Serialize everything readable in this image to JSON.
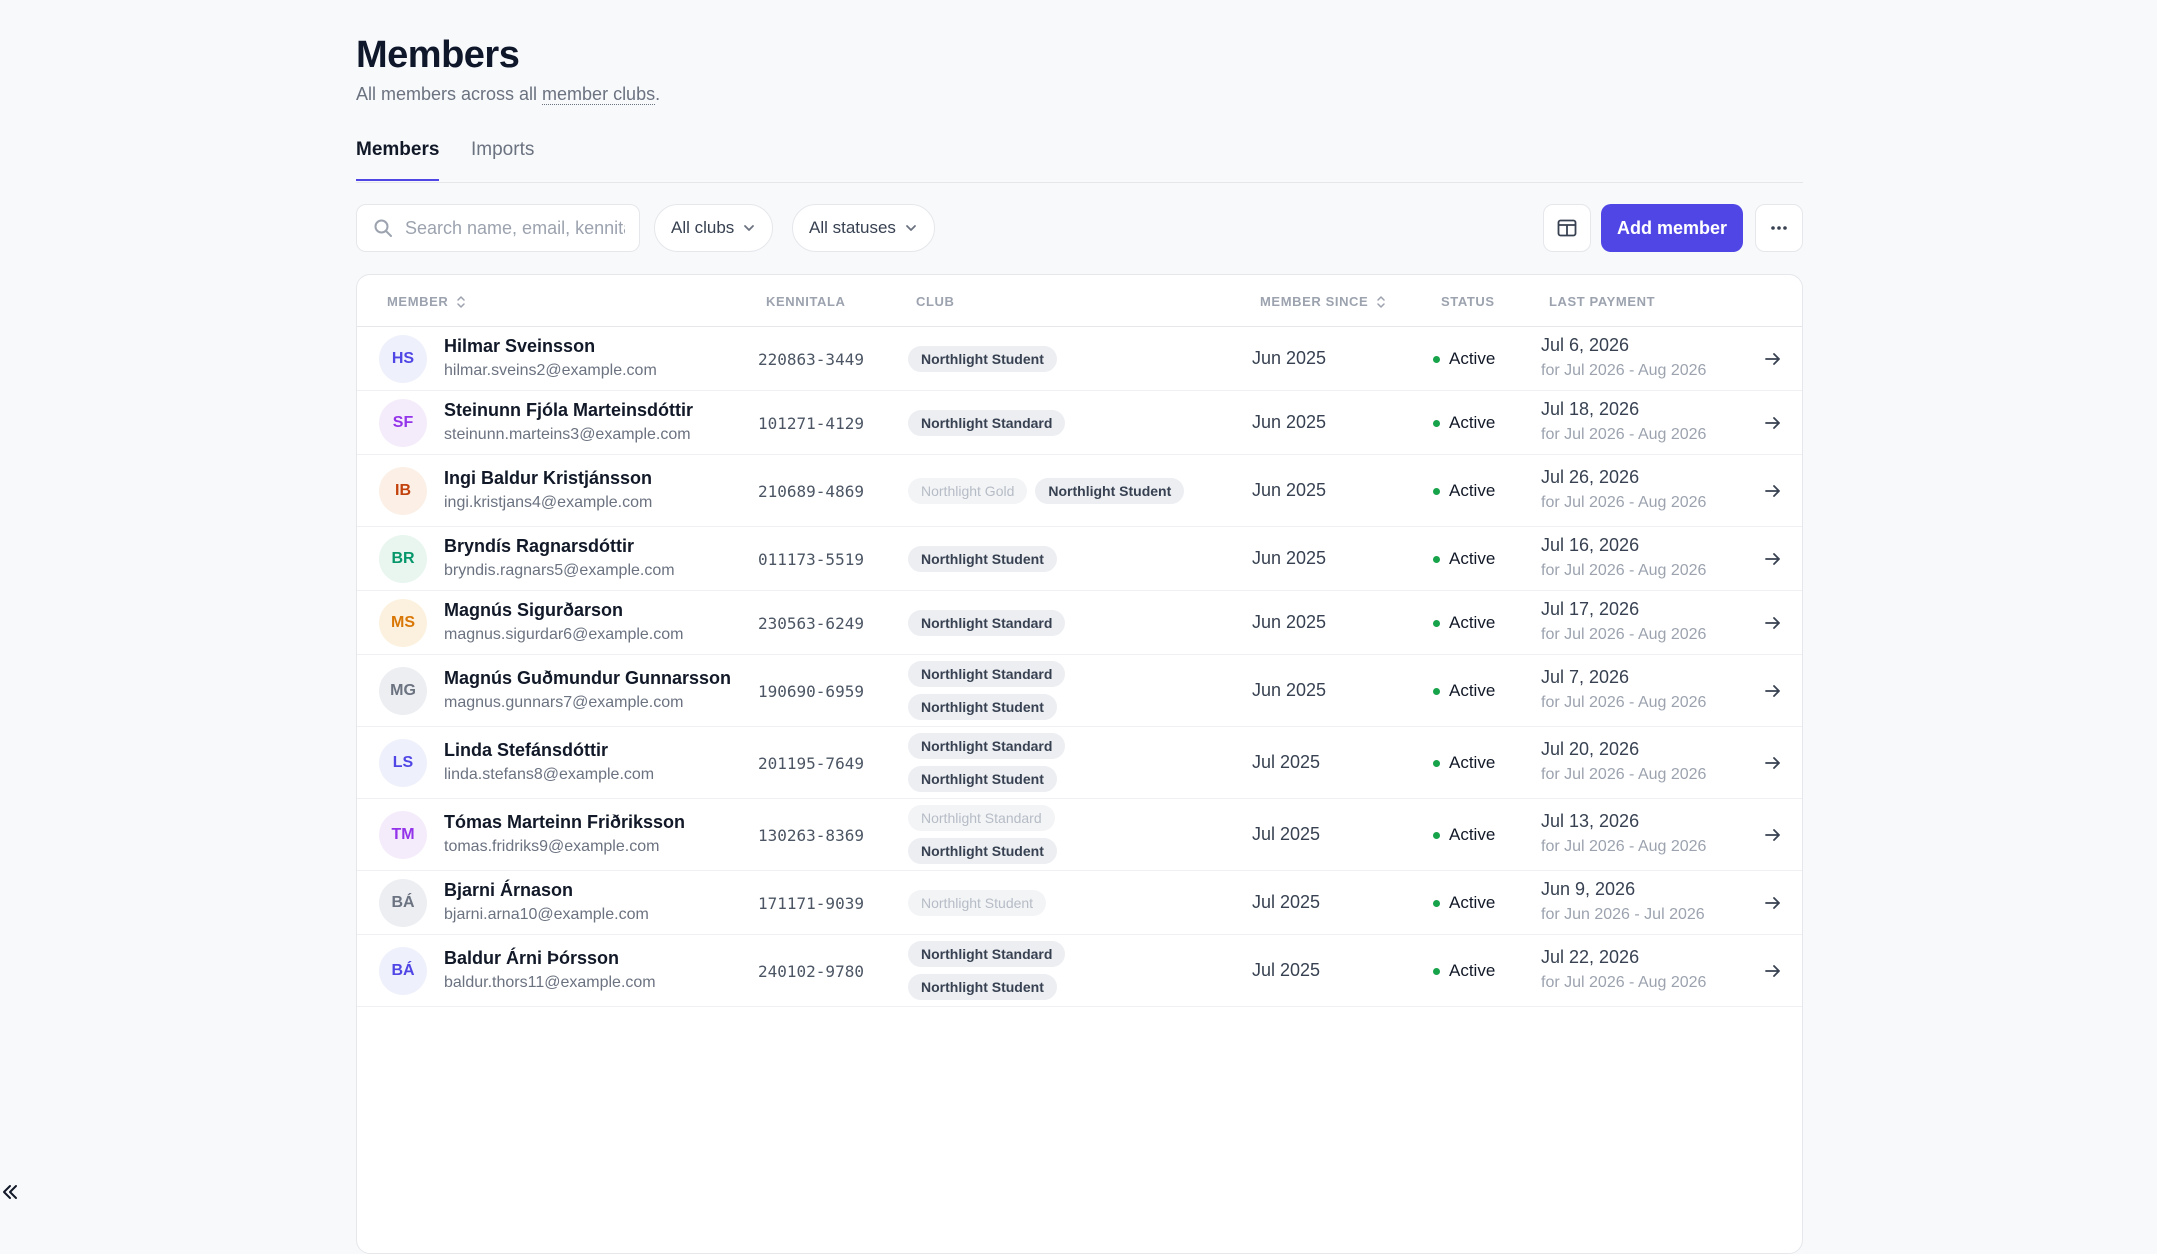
{
  "header": {
    "title": "Members",
    "subtitle_prefix": "All members across all ",
    "subtitle_link": "member clubs",
    "subtitle_suffix": "."
  },
  "tabs": [
    {
      "label": "Members",
      "active": true
    },
    {
      "label": "Imports",
      "active": false
    }
  ],
  "toolbar": {
    "search_placeholder": "Search name, email, kennitala",
    "clubs_filter": "All clubs",
    "status_filter": "All statuses",
    "add_member_label": "Add member"
  },
  "table": {
    "columns": {
      "member": "MEMBER",
      "kennitala": "KENNITALA",
      "club": "CLUB",
      "member_since": "MEMBER SINCE",
      "status": "STATUS",
      "last_payment": "LAST PAYMENT"
    },
    "rows": [
      {
        "initials": "HS",
        "avatar_bg": "#eef0fb",
        "avatar_fg": "#4f46e5",
        "name": "Hilmar Sveinsson",
        "email": "hilmar.sveins2@example.com",
        "kennitala": "220863-3449",
        "clubs": [
          {
            "name": "Northlight Student",
            "active": true
          }
        ],
        "since": "Jun 2025",
        "status": "Active",
        "pay_date": "Jul 6, 2026",
        "pay_range": "for Jul 2026 - Aug 2026"
      },
      {
        "initials": "SF",
        "avatar_bg": "#f5ecfb",
        "avatar_fg": "#9333ea",
        "name": "Steinunn Fjóla Marteinsdóttir",
        "email": "steinunn.marteins3@example.com",
        "kennitala": "101271-4129",
        "clubs": [
          {
            "name": "Northlight Standard",
            "active": true
          }
        ],
        "since": "Jun 2025",
        "status": "Active",
        "pay_date": "Jul 18, 2026",
        "pay_range": "for Jul 2026 - Aug 2026"
      },
      {
        "initials": "IB",
        "avatar_bg": "#fbefe6",
        "avatar_fg": "#c2410c",
        "name": "Ingi Baldur Kristjánsson",
        "email": "ingi.kristjans4@example.com",
        "kennitala": "210689-4869",
        "clubs": [
          {
            "name": "Northlight Gold",
            "active": false
          },
          {
            "name": "Northlight Student",
            "active": true
          }
        ],
        "since": "Jun 2025",
        "status": "Active",
        "pay_date": "Jul 26, 2026",
        "pay_range": "for Jul 2026 - Aug 2026"
      },
      {
        "initials": "BR",
        "avatar_bg": "#e8f6ef",
        "avatar_fg": "#059669",
        "name": "Bryndís Ragnarsdóttir",
        "email": "bryndis.ragnars5@example.com",
        "kennitala": "011173-5519",
        "clubs": [
          {
            "name": "Northlight Student",
            "active": true
          }
        ],
        "since": "Jun 2025",
        "status": "Active",
        "pay_date": "Jul 16, 2026",
        "pay_range": "for Jul 2026 - Aug 2026"
      },
      {
        "initials": "MS",
        "avatar_bg": "#fcf1de",
        "avatar_fg": "#d97706",
        "name": "Magnús Sigurðarson",
        "email": "magnus.sigurdar6@example.com",
        "kennitala": "230563-6249",
        "clubs": [
          {
            "name": "Northlight Standard",
            "active": true
          }
        ],
        "since": "Jun 2025",
        "status": "Active",
        "pay_date": "Jul 17, 2026",
        "pay_range": "for Jul 2026 - Aug 2026"
      },
      {
        "initials": "MG",
        "avatar_bg": "#eceef2",
        "avatar_fg": "#6b7280",
        "name": "Magnús Guðmundur Gunnarsson",
        "email": "magnus.gunnars7@example.com",
        "kennitala": "190690-6959",
        "clubs": [
          {
            "name": "Northlight Standard",
            "active": true
          },
          {
            "name": "Northlight Student",
            "active": true
          }
        ],
        "since": "Jun 2025",
        "status": "Active",
        "pay_date": "Jul 7, 2026",
        "pay_range": "for Jul 2026 - Aug 2026"
      },
      {
        "initials": "LS",
        "avatar_bg": "#eef0fb",
        "avatar_fg": "#4f46e5",
        "name": "Linda Stefánsdóttir",
        "email": "linda.stefans8@example.com",
        "kennitala": "201195-7649",
        "clubs": [
          {
            "name": "Northlight Standard",
            "active": true
          },
          {
            "name": "Northlight Student",
            "active": true
          }
        ],
        "since": "Jul 2025",
        "status": "Active",
        "pay_date": "Jul 20, 2026",
        "pay_range": "for Jul 2026 - Aug 2026"
      },
      {
        "initials": "TM",
        "avatar_bg": "#f5ecfb",
        "avatar_fg": "#9333ea",
        "name": "Tómas Marteinn Friðriksson",
        "email": "tomas.fridriks9@example.com",
        "kennitala": "130263-8369",
        "clubs": [
          {
            "name": "Northlight Standard",
            "active": false
          },
          {
            "name": "Northlight Student",
            "active": true
          }
        ],
        "since": "Jul 2025",
        "status": "Active",
        "pay_date": "Jul 13, 2026",
        "pay_range": "for Jul 2026 - Aug 2026"
      },
      {
        "initials": "BÁ",
        "avatar_bg": "#eceef2",
        "avatar_fg": "#6b7280",
        "name": "Bjarni Árnason",
        "email": "bjarni.arna10@example.com",
        "kennitala": "171171-9039",
        "clubs": [
          {
            "name": "Northlight Student",
            "active": false
          }
        ],
        "since": "Jul 2025",
        "status": "Active",
        "pay_date": "Jun 9, 2026",
        "pay_range": "for Jun 2026 - Jul 2026"
      },
      {
        "initials": "BÁ",
        "avatar_bg": "#eef0fb",
        "avatar_fg": "#4f46e5",
        "name": "Baldur Árni Þórsson",
        "email": "baldur.thors11@example.com",
        "kennitala": "240102-9780",
        "clubs": [
          {
            "name": "Northlight Standard",
            "active": true
          },
          {
            "name": "Northlight Student",
            "active": true
          }
        ],
        "since": "Jul 2025",
        "status": "Active",
        "pay_date": "Jul 22, 2026",
        "pay_range": "for Jul 2026 - Aug 2026"
      }
    ]
  }
}
